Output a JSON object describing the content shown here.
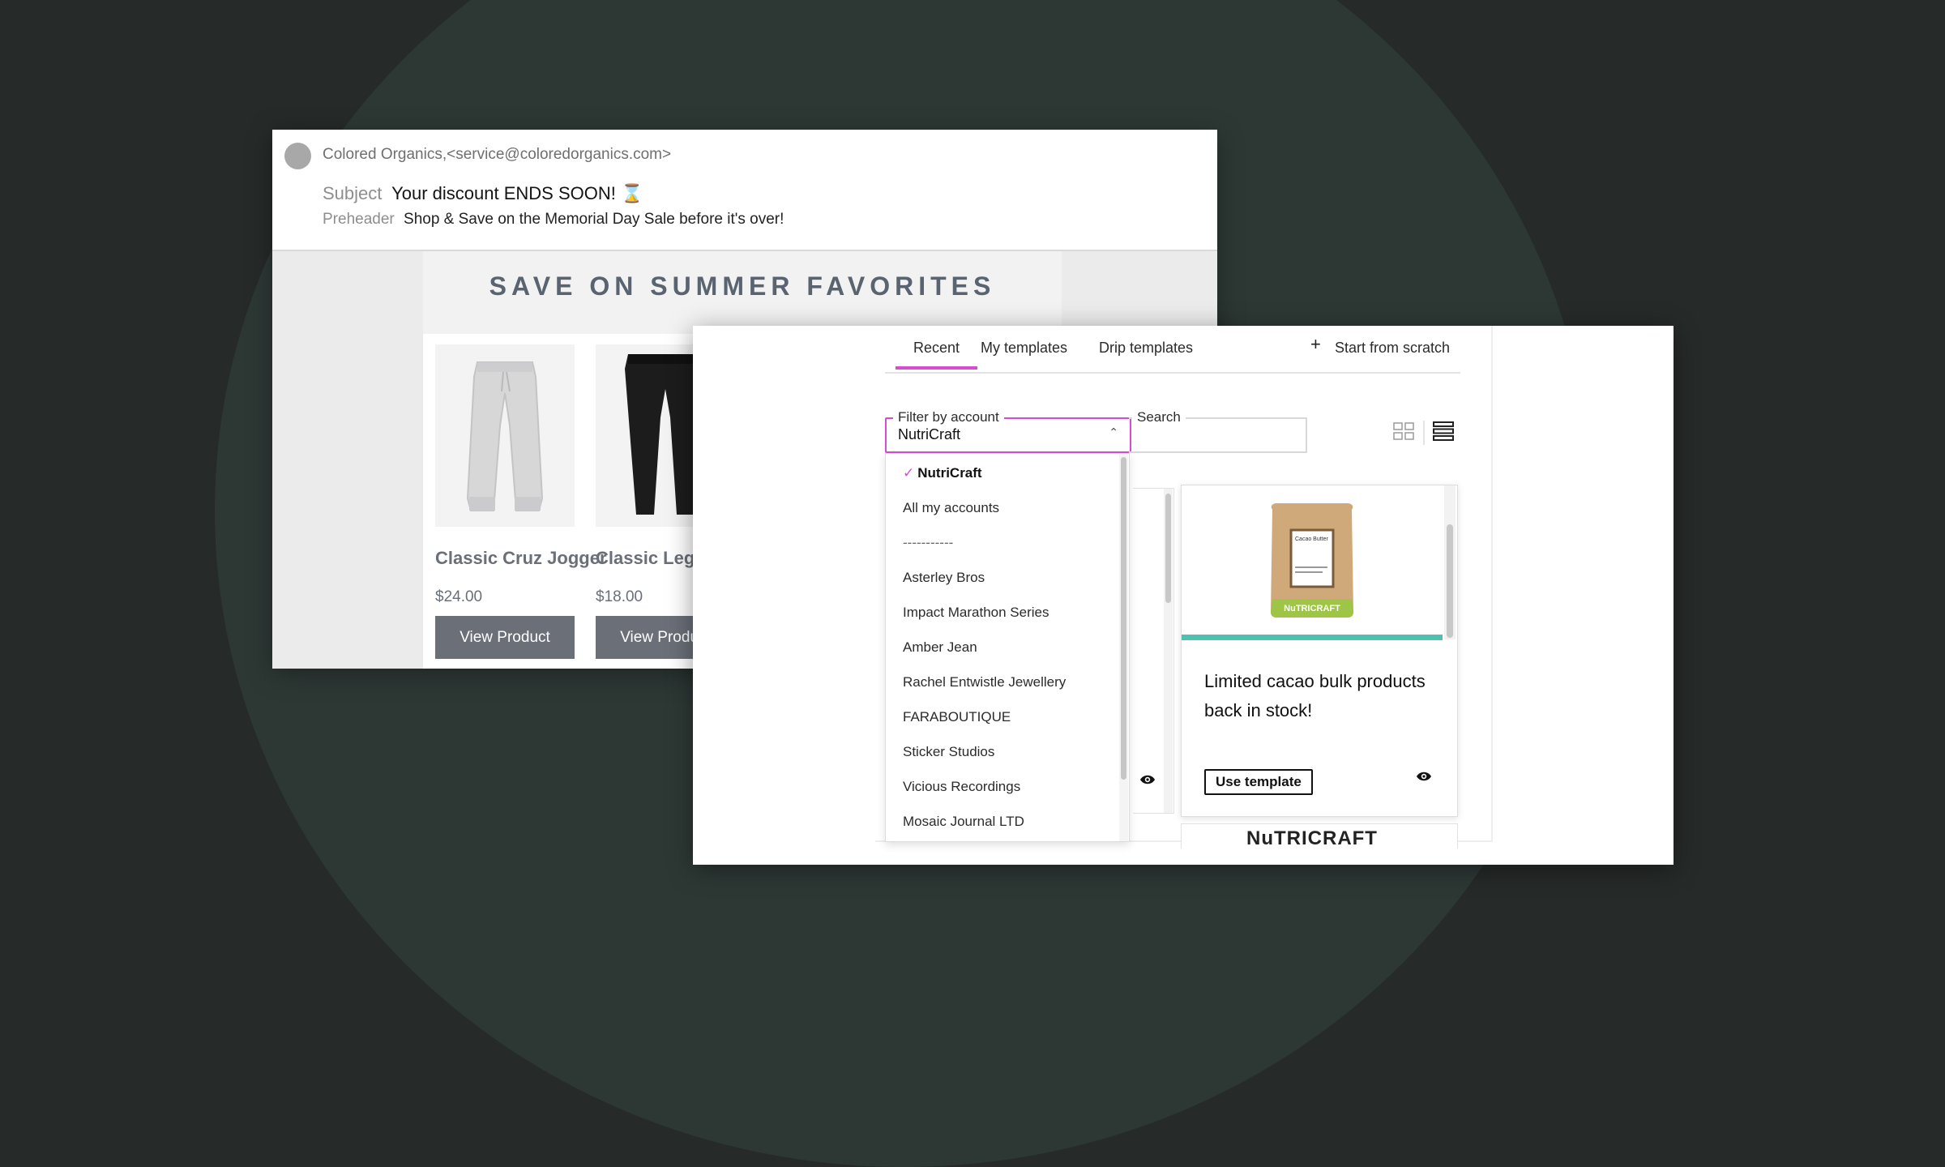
{
  "email": {
    "from": "Colored Organics,<service@coloredorganics.com>",
    "subject_label": "Subject",
    "subject": "Your discount ENDS SOON! ⌛",
    "preheader_label": "Preheader",
    "preheader": "Shop & Save on the Memorial Day Sale before it's over!",
    "headline": "SAVE ON SUMMER FAVORITES",
    "products": [
      {
        "name": "Classic Cruz Jogger",
        "price": "$24.00",
        "button": "View Product"
      },
      {
        "name": "Classic Legging",
        "price": "$18.00",
        "button": "View Product"
      }
    ]
  },
  "templates": {
    "tabs": [
      "Recent",
      "My templates",
      "Drip templates"
    ],
    "active_tab": "Recent",
    "start_from_scratch": "Start from scratch",
    "filter_label": "Filter by account",
    "filter_value": "NutriCraft",
    "search_label": "Search",
    "dropdown": {
      "selected_mark": "✓",
      "items": [
        "NutriCraft",
        "All my accounts",
        "-----------",
        "Asterley Bros",
        "Impact Marathon Series",
        "Amber Jean",
        "Rachel Entwistle Jewellery",
        "FARABOUTIQUE",
        "Sticker Studios",
        "Vicious Recordings",
        "Mosaic Journal LTD"
      ]
    },
    "card": {
      "title": "Limited cacao bulk products back in stock!",
      "use_button": "Use template",
      "package_label": "Cacao Butter",
      "package_brand": "NuTRICRAFT"
    },
    "next_card_logo": "NuTRICRAFT"
  },
  "colors": {
    "accent": "#d64dd2",
    "card_bar": "#4fc1b0",
    "product_button": "#6a6f78",
    "background": "#262a29"
  }
}
